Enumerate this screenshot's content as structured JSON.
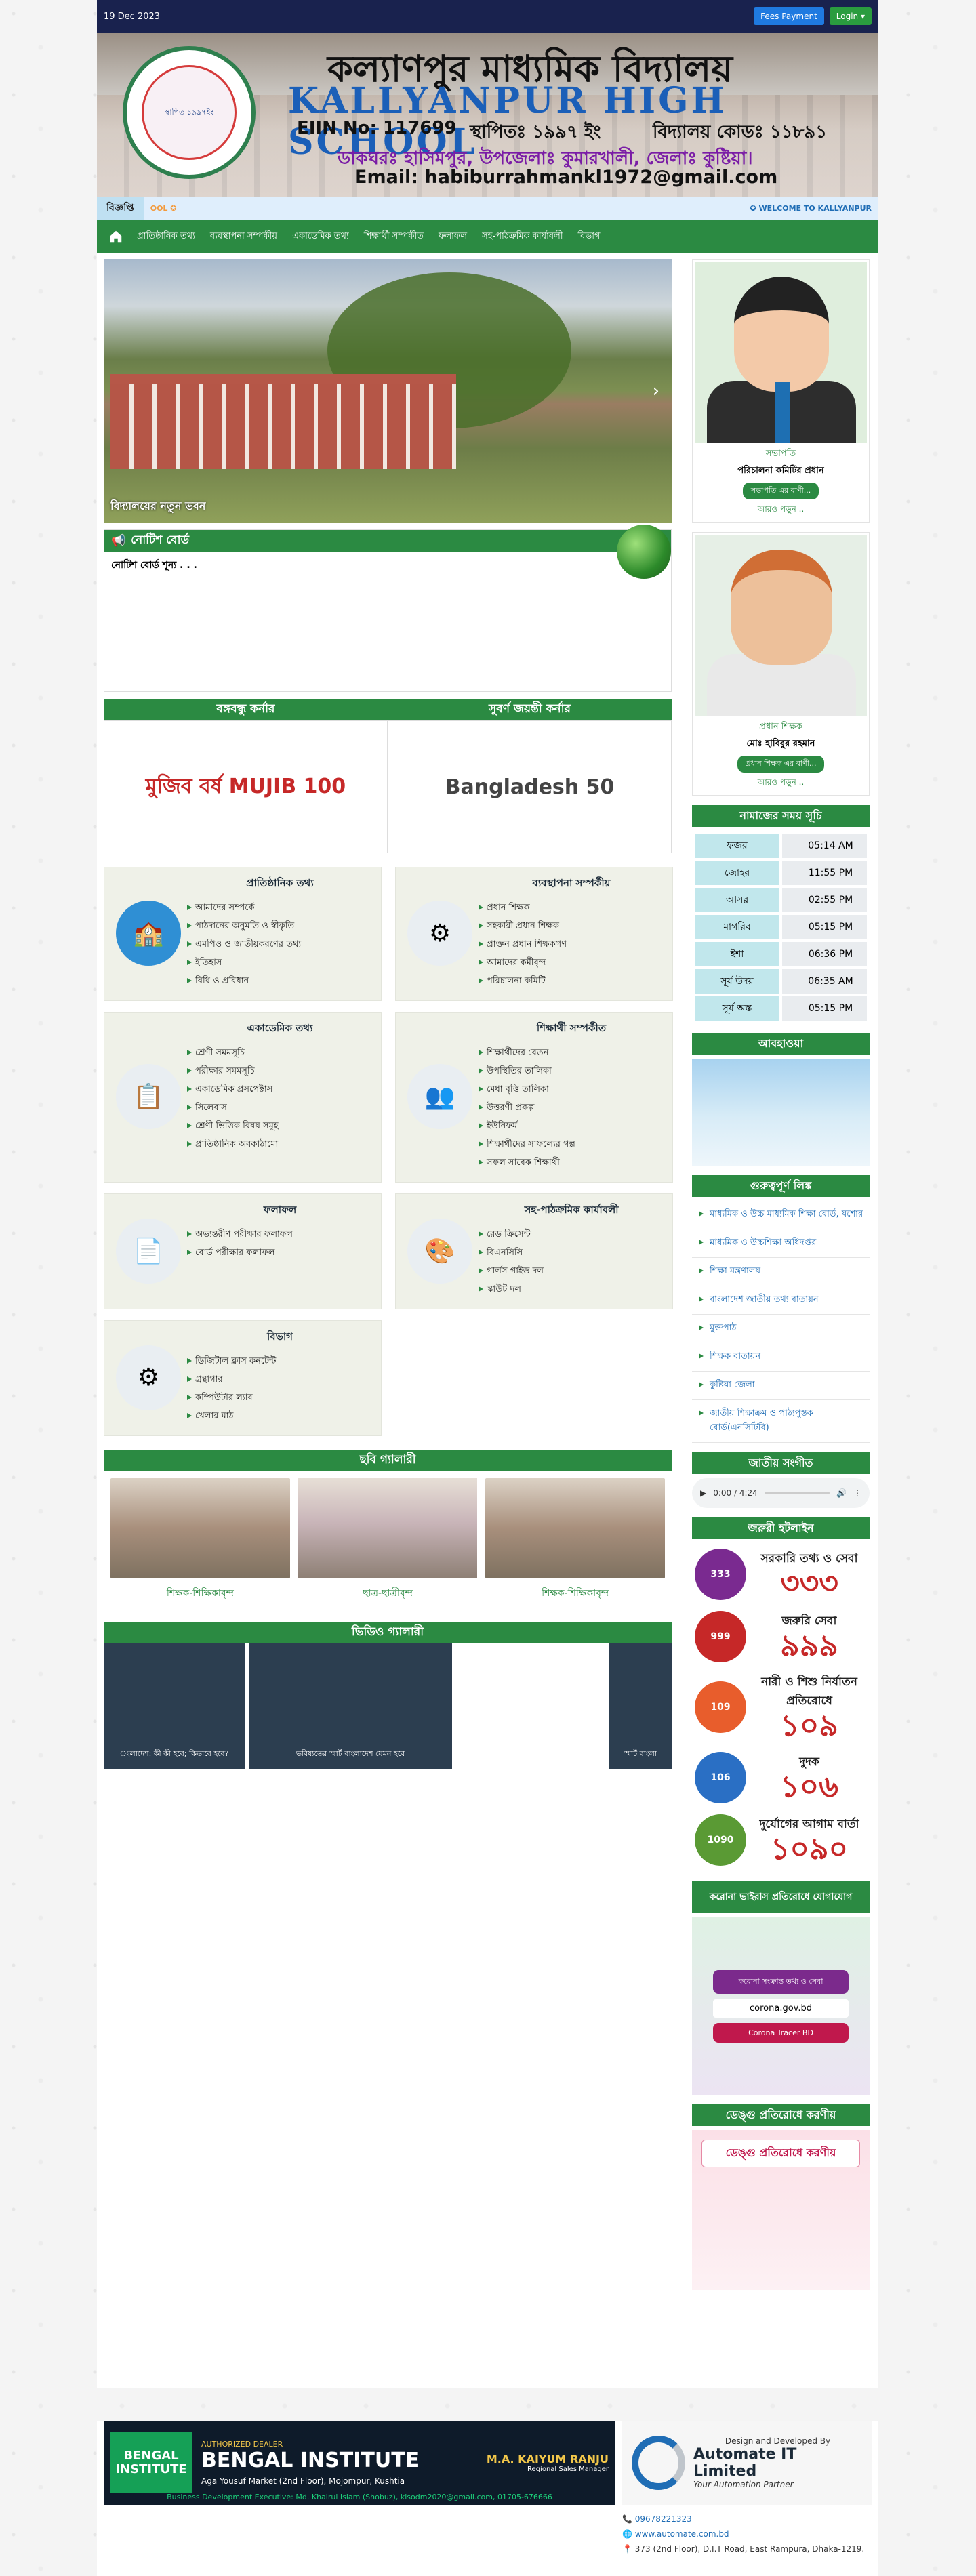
{
  "topbar": {
    "date": "19 Dec 2023",
    "fees_label": "Fees Payment",
    "login_label": "Login ▾"
  },
  "header": {
    "title_bn": "কল্যাণপুর মাধ্যমিক বিদ্যালয়",
    "title_en": "KALLYANPUR HIGH SCHOOL",
    "eiin": "EIIN No: 117699",
    "established": "স্থাপিতঃ ১৯৯৭ ইং",
    "code": "বিদ্যালয় কোডঃ ১১৮৯১",
    "address": "ডাকঘরঃ হাসিমপুর, উপজেলাঃ কুমারখালী, জেলাঃ কুষ্টিয়া।",
    "email": "Email: habiburrahmankl1972@gmail.com",
    "logo_text": "স্থাপিত ১৯৯৭ইং"
  },
  "ticker": {
    "label": "বিজ্ঞপ্তি",
    "msg_left": "OOL ✪",
    "msg_right": "✪ WELCOME TO KALLYANPUR"
  },
  "nav": [
    "প্রাতিষ্ঠানিক তথ্য",
    "ব্যবস্থাপনা সম্পর্কীয়",
    "একাডেমিক তথ্য",
    "শিক্ষার্থী সম্পর্কীত",
    "ফলাফল",
    "সহ-পাঠক্রমিক কার্যাবলী",
    "বিভাগ"
  ],
  "slider": {
    "caption": "বিদ্যালয়ের নতুন ভবন",
    "next": "›"
  },
  "notice": {
    "title": "নোটিশ বোর্ড",
    "empty": "নোটিশ বোর্ড শূন্য . . ."
  },
  "corners": {
    "left_title": "বঙ্গবন্ধু কর্নার",
    "right_title": "সুবর্ণ জয়ন্তী কর্নার",
    "left_img": "মুজিব বর্ষ MUJIB 100",
    "right_img": "Bangladesh 50"
  },
  "cards": [
    {
      "title": "প্রাতিষ্ঠানিক তথ্য",
      "icon": "🏫",
      "color": "#2f8fd4",
      "items": [
        "আমাদের সম্পর্কে",
        "পাঠদানের অনুমতি ও স্বীকৃতি",
        "এমপিও ও জাতীয়করণের তথ্য",
        "ইতিহাস",
        "বিধি ও প্রবিধান"
      ]
    },
    {
      "title": "ব্যবস্থাপনা সম্পর্কীয়",
      "icon": "⚙",
      "color": "#e9eef2",
      "items": [
        "প্রধান শিক্ষক",
        "সহকারী প্রধান শিক্ষক",
        "প্রাক্তন প্রধান শিক্ষকগণ",
        "আমাদের কর্মীবৃন্দ",
        "পরিচালনা কমিটি"
      ]
    },
    {
      "title": "একাডেমিক তথ্য",
      "icon": "📋",
      "color": "#e9eef2",
      "items": [
        "শ্রেণী সমমসূচি",
        "পরীক্ষার সমমসূচি",
        "একাডেমিক প্রসপেক্টাস",
        "সিলেবাস",
        "শ্রেণী ভিত্তিক বিষয় সমূহ",
        "প্রাতিষ্ঠানিক অবকাঠামো"
      ]
    },
    {
      "title": "শিক্ষার্থী সম্পর্কীত",
      "icon": "👥",
      "color": "#e9eef2",
      "items": [
        "শিক্ষার্থীদের বেতন",
        "উপস্থিতির তালিকা",
        "মেধা বৃত্তি তালিকা",
        "উত্তরণী প্রকল্প",
        "ইউনিফর্ম",
        "শিক্ষার্থীদের সাফল্যের গল্প",
        "সফল সাবেক শিক্ষার্থী"
      ]
    },
    {
      "title": "ফলাফল",
      "icon": "📄",
      "color": "#e9eef2",
      "items": [
        "অভ্যন্তরীণ পরীক্ষার ফলাফল",
        "বোর্ড পরীক্ষার ফলাফল"
      ]
    },
    {
      "title": "সহ-পাঠক্রমিক কার্যাবলী",
      "icon": "🎨",
      "color": "#e9eef2",
      "items": [
        "রেড ক্রিসেন্ট",
        "বিএনসিসি",
        "গার্লস গাইড দল",
        "স্কাউট দল"
      ]
    },
    {
      "title": "বিভাগ",
      "icon": "⚙",
      "color": "#e9eef2",
      "items": [
        "ডিজিটাল ক্লাস কনটেন্ট",
        "গ্রন্থাগার",
        "কম্পিউটার ল্যাব",
        "খেলার মাঠ"
      ]
    }
  ],
  "photo_gallery": {
    "title": "ছবি গ্যালারী",
    "items": [
      "শিক্ষক-শিক্ষিকাবৃন্দ",
      "ছাত্র-ছাত্রীবৃন্দ",
      "শিক্ষক-শিক্ষিকাবৃন্দ"
    ]
  },
  "video_gallery": {
    "title": "ভিডিও গ্যালারী",
    "items": [
      "ংলাদেশ: কী কী হবে; কিভাবে হবে?",
      "ভবিষ্যতের স্মার্ট বাংলাদেশ যেমন হবে",
      "স্মার্ট বাংলা"
    ]
  },
  "president": {
    "position": "সভাপতি",
    "name": "পরিচালনা কমিটির প্রধান",
    "pill": "সভাপতি এর বাণী...",
    "more": "আরও পড়ুন .."
  },
  "headmaster": {
    "position": "প্রধান শিক্ষক",
    "name": "মোঃ হাবিবুর রহমান",
    "pill": "প্রধান শিক্ষক এর বাণী...",
    "more": "আরও পড়ুন .."
  },
  "prayer": {
    "title": "নামাজের সময় সূচি",
    "rows": [
      [
        "ফজর",
        "05:14 AM"
      ],
      [
        "জোহর",
        "11:55 PM"
      ],
      [
        "আসর",
        "02:55 PM"
      ],
      [
        "মাগরিব",
        "05:15 PM"
      ],
      [
        "ইশা",
        "06:36 PM"
      ],
      [
        "সূর্য উদয়",
        "06:35 AM"
      ],
      [
        "সূর্য অস্ত",
        "05:15 PM"
      ]
    ]
  },
  "weather": {
    "title": "আবহাওয়া"
  },
  "important_links": {
    "title": "গুরুত্বপূর্ণ লিঙ্ক",
    "items": [
      "মাধ্যমিক ও উচ্চ মাধ্যমিক শিক্ষা বোর্ড, যশোর",
      "মাধ্যমিক ও উচ্চশিক্ষা অধিদপ্তর",
      "শিক্ষা মন্ত্রণালয়",
      "বাংলাদেশ জাতীয় তথ্য বাতায়ন",
      "মুক্তপাঠ",
      "শিক্ষক বাতায়ন",
      "কুষ্টিয়া জেলা",
      "জাতীয় শিক্ষাক্রম ও পাঠ্যপুস্তক বোর্ড(এনসিটিবি)"
    ]
  },
  "anthem": {
    "title": "জাতীয় সংগীত",
    "time": "0:00 / 4:24"
  },
  "hotline": {
    "title": "জরুরী হটলাইন",
    "items": [
      {
        "label": "সরকারি তথ্য ও সেবা",
        "number": "৩৩৩",
        "icon": "333",
        "color": "#7a2a90"
      },
      {
        "label": "জরুরি সেবা",
        "number": "৯৯৯",
        "icon": "999",
        "color": "#c62828"
      },
      {
        "label": "নারী ও শিশু নির্যাতন প্রতিরোধে",
        "number": "১০৯",
        "icon": "109",
        "color": "#e85d2c"
      },
      {
        "label": "দুদক",
        "number": "১০৬",
        "icon": "106",
        "color": "#2a6fc4"
      },
      {
        "label": "দুর্যোগের আগাম বার্তা",
        "number": "১০৯০",
        "icon": "1090",
        "color": "#5a9a34"
      }
    ]
  },
  "corona": {
    "title": "করোনা ভাইরাস প্রতিরোধে যোগাযোগ",
    "box": "করোনা সংক্রান্ত তথ্য ও সেবা",
    "site": "corona.gov.bd",
    "app": "Corona Tracer BD"
  },
  "dengue": {
    "title": "ডেঙ্গু প্রতিরোধে করণীয়",
    "banner": "ডেঙ্গু প্রতিরোধে করণীয়"
  },
  "footer": {
    "dealer": "AUTHORIZED DEALER",
    "institute": "BENGAL INSTITUTE",
    "institute_logo": "BENGAL INSTITUTE",
    "address": "Aga Yousuf Market (2nd Floor), Mojompur, Kushtia",
    "manager_name": "M.A. KAIYUM RANJU",
    "manager_role": "Regional Sales Manager",
    "exec": "Business Development Executive: Md. Khairul Islam (Shobuz), kisodm2020@gmail.com, 01705-676666",
    "designed_by": "Design and Developed By",
    "company": "Automate IT Limited",
    "tagline": "Your Automation Partner",
    "phone": "09678221323",
    "web": "www.automate.com.bd",
    "addr": "373 (2nd Floor), D.I.T Road, East Rampura, Dhaka-1219."
  }
}
